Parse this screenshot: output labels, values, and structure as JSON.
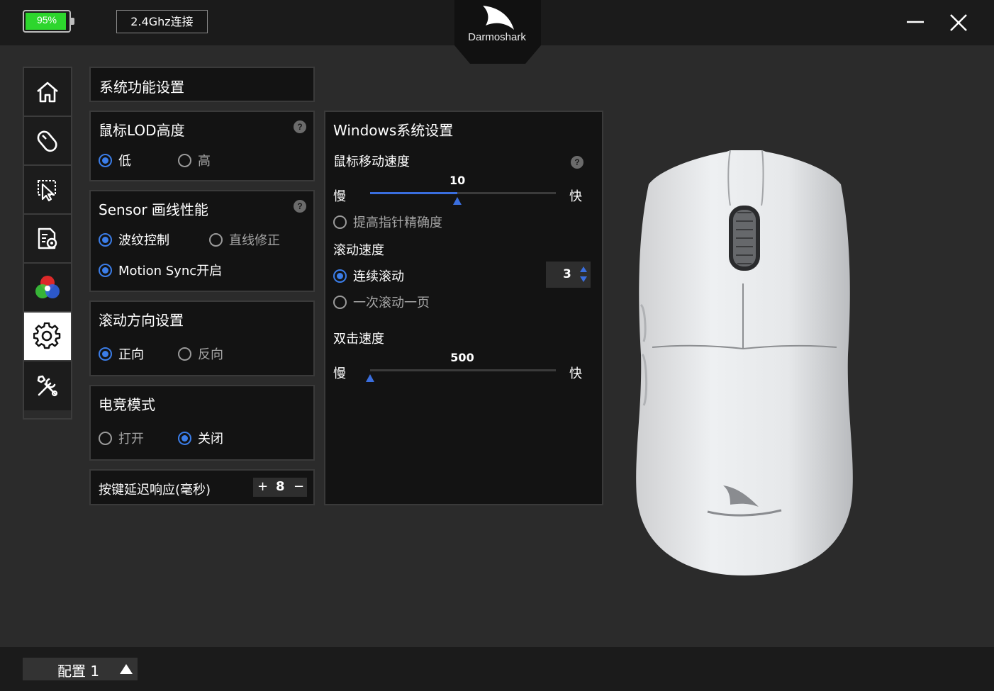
{
  "topbar": {
    "battery_percent": "95%",
    "battery_level": 0.95,
    "connection_label": "2.4Ghz连接",
    "brand": "Darmoshark"
  },
  "sidebar": {
    "items": [
      {
        "name": "home",
        "icon": "home-icon"
      },
      {
        "name": "buttons",
        "icon": "mouse-icon"
      },
      {
        "name": "macro",
        "icon": "pointer-icon"
      },
      {
        "name": "performance",
        "icon": "document-gear-icon"
      },
      {
        "name": "lighting",
        "icon": "rgb-icon"
      },
      {
        "name": "settings",
        "icon": "gear-icon",
        "active": true
      },
      {
        "name": "tools",
        "icon": "tools-icon"
      }
    ]
  },
  "section_title": "系统功能设置",
  "lod": {
    "title": "鼠标LOD高度",
    "help": "?",
    "options": [
      {
        "label": "低",
        "selected": true
      },
      {
        "label": "高",
        "selected": false
      }
    ]
  },
  "sensor": {
    "title": "Sensor 画线性能",
    "help": "?",
    "options": [
      {
        "label": "波纹控制",
        "selected": true
      },
      {
        "label": "直线修正",
        "selected": false
      },
      {
        "label": "Motion Sync开启",
        "selected": true
      }
    ]
  },
  "scroll_direction": {
    "title": "滚动方向设置",
    "options": [
      {
        "label": "正向",
        "selected": true
      },
      {
        "label": "反向",
        "selected": false
      }
    ]
  },
  "esports": {
    "title": "电竞模式",
    "options": [
      {
        "label": "打开",
        "selected": false
      },
      {
        "label": "关闭",
        "selected": true
      }
    ]
  },
  "latency": {
    "label": "按键延迟响应(毫秒)",
    "plus": "+",
    "value": "8",
    "minus": "−"
  },
  "windows": {
    "title": "Windows系统设置",
    "pointer_speed": {
      "label": "鼠标移动速度",
      "help": "?",
      "value": "10",
      "fraction": 0.47,
      "slow": "慢",
      "fast": "快"
    },
    "precision": {
      "label": "提高指针精确度",
      "selected": false
    },
    "scroll_speed": {
      "label": "滚动速度",
      "continuous": {
        "label": "连续滚动",
        "selected": true
      },
      "lines": "3",
      "page": {
        "label": "一次滚动一页",
        "selected": false
      }
    },
    "double_click": {
      "label": "双击速度",
      "value": "500",
      "fraction": 0.0,
      "slow": "慢",
      "fast": "快"
    }
  },
  "profile": {
    "label": "配置 1"
  },
  "colors": {
    "accent": "#3b7de8",
    "battery": "#2dd62d",
    "panel": "#131313",
    "background": "#2b2b2b"
  }
}
